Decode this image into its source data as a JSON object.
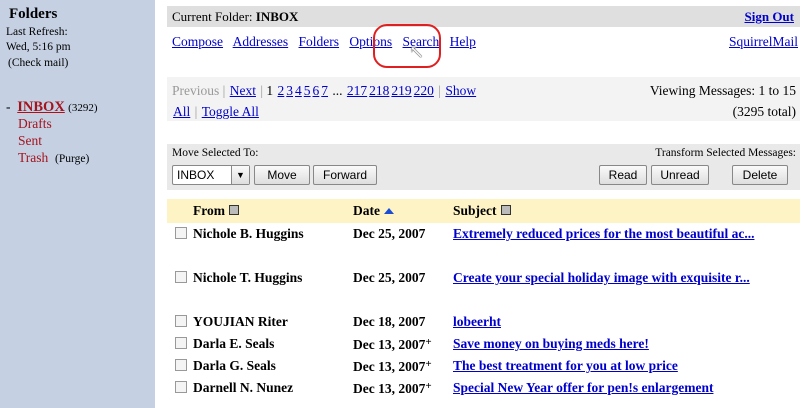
{
  "left": {
    "title": "Folders",
    "last_refresh_label": "Last Refresh:",
    "last_refresh_value": "Wed, 5:16 pm",
    "check_mail": "(Check mail)",
    "folders": [
      {
        "prefix": "-",
        "name": "INBOX",
        "count": "(3292)",
        "extra": ""
      },
      {
        "prefix": "",
        "name": "Drafts",
        "count": "",
        "extra": ""
      },
      {
        "prefix": "",
        "name": "Sent",
        "count": "",
        "extra": ""
      },
      {
        "prefix": "",
        "name": "Trash",
        "count": "",
        "extra": "(Purge)"
      }
    ]
  },
  "topbar": {
    "current_folder_label": "Current Folder:",
    "current_folder": "INBOX",
    "sign_out": "Sign Out"
  },
  "menu": {
    "items": [
      "Compose",
      "Addresses",
      "Folders",
      "Options",
      "Search",
      "Help"
    ],
    "brand_link": "SquirrelMail"
  },
  "pager": {
    "previous": "Previous",
    "next": "Next",
    "current_page": "1",
    "pages": [
      "2",
      "3",
      "4",
      "5",
      "6",
      "7"
    ],
    "ellipsis": "...",
    "last_pages": [
      "217",
      "218",
      "219",
      "220"
    ],
    "show": "Show",
    "all": "All",
    "toggle_all": "Toggle All",
    "viewing": "Viewing Messages: 1 to 15",
    "total": "(3295 total)"
  },
  "actions": {
    "move_label": "Move Selected To:",
    "transform_label": "Transform Selected Messages:",
    "folder_select": "INBOX",
    "move_button": "Move",
    "forward_button": "Forward",
    "read_button": "Read",
    "unread_button": "Unread",
    "delete_button": "Delete"
  },
  "table": {
    "headers": {
      "from": "From",
      "date": "Date",
      "subject": "Subject"
    },
    "rows": [
      {
        "from": "Nichole B. Huggins",
        "date": "Dec 25, 2007",
        "plus": "",
        "subject": "Extremely reduced prices for the most beautiful ac..."
      },
      {
        "from": "Nichole T. Huggins",
        "date": "Dec 25, 2007",
        "plus": "",
        "subject": "Create your special holiday image with exquisite r..."
      },
      {
        "from": "YOUJIAN Riter",
        "date": "Dec 18, 2007",
        "plus": "",
        "subject": "lobeerht"
      },
      {
        "from": "Darla E. Seals",
        "date": "Dec 13, 2007",
        "plus": "+",
        "subject": "Save money on buying meds here!"
      },
      {
        "from": "Darla G. Seals",
        "date": "Dec 13, 2007",
        "plus": "+",
        "subject": "The best treatment for you at low price"
      },
      {
        "from": "Darnell N. Nunez",
        "date": "Dec 13, 2007",
        "plus": "+",
        "subject": "Special New Year offer for pen!s enlargement"
      }
    ]
  },
  "colors": {
    "left_pane": "#c5d1e3",
    "folder_text": "#a4141e",
    "link": "#0000cc",
    "header_bar": "#dfdfdf",
    "table_header": "#fdf3c4",
    "highlight_circle": "#e02020"
  }
}
